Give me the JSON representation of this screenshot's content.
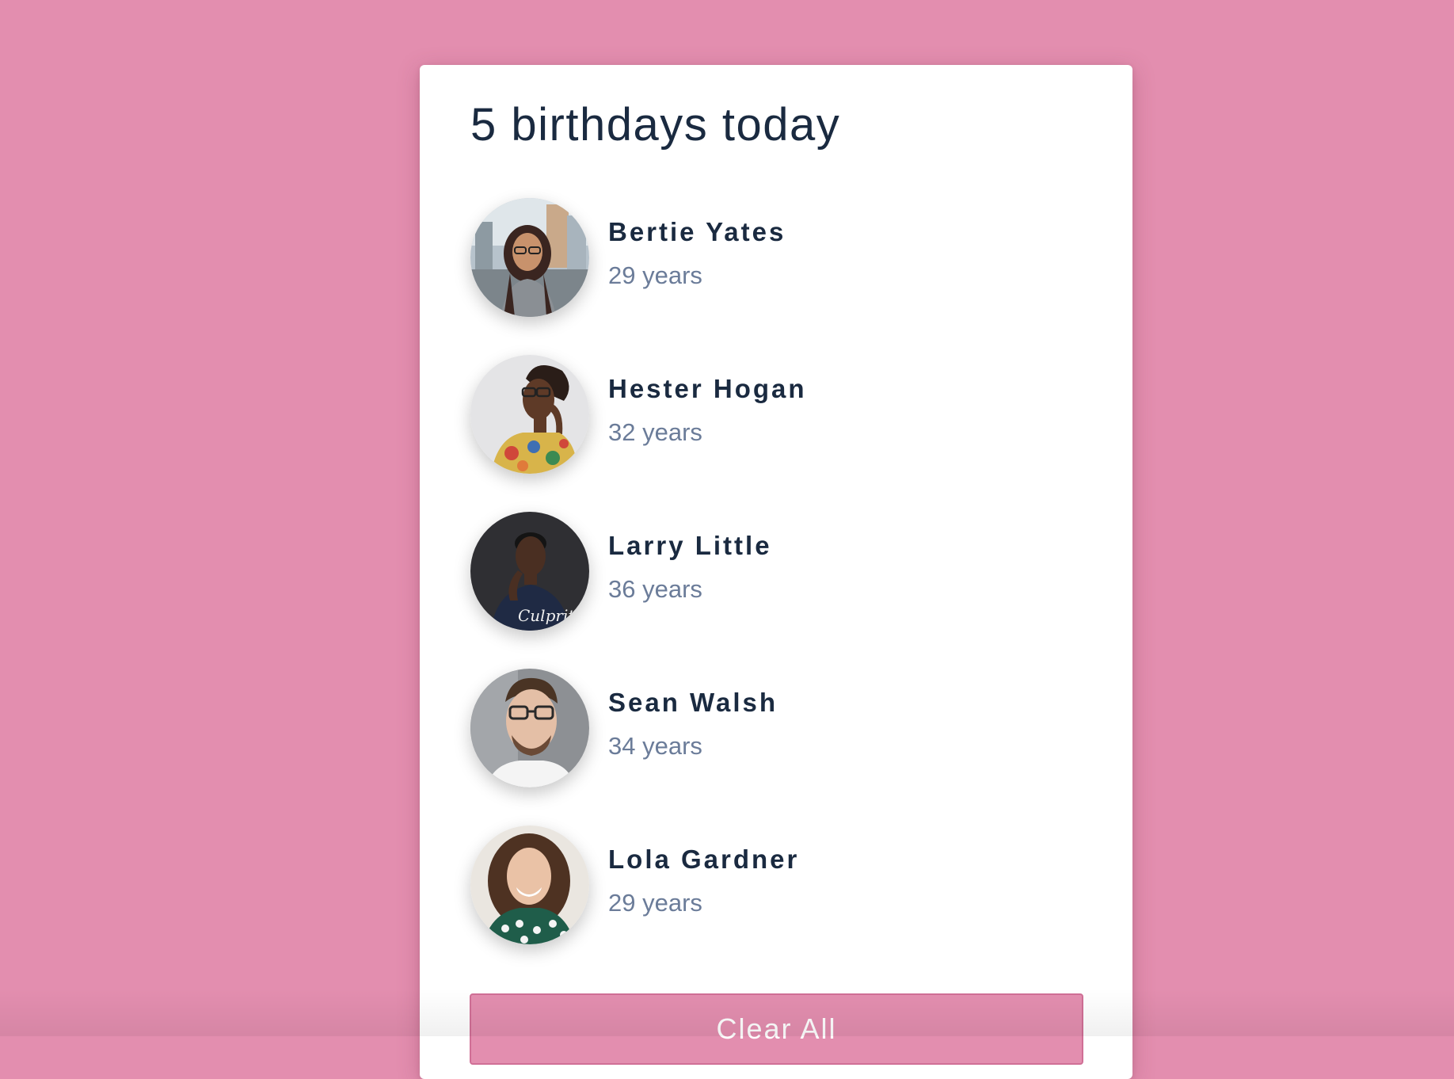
{
  "header": {
    "title": "5 birthdays today"
  },
  "people": [
    {
      "name": "Bertie Yates",
      "age": "29 years",
      "avatar_icon": "avatar-woman-glasses-street"
    },
    {
      "name": "Hester Hogan",
      "age": "32 years",
      "avatar_icon": "avatar-woman-floral-shirt"
    },
    {
      "name": "Larry Little",
      "age": "36 years",
      "avatar_icon": "avatar-man-dark-tshirt"
    },
    {
      "name": "Sean Walsh",
      "age": "34 years",
      "avatar_icon": "avatar-man-glasses"
    },
    {
      "name": "Lola Gardner",
      "age": "29 years",
      "avatar_icon": "avatar-woman-curly-hair"
    }
  ],
  "actions": {
    "clear_label": "Clear All"
  },
  "colors": {
    "background": "#e38eaf",
    "card": "#ffffff",
    "title_text": "#1a2a40",
    "age_text": "#6b7c99",
    "button": "#e38eaf"
  }
}
